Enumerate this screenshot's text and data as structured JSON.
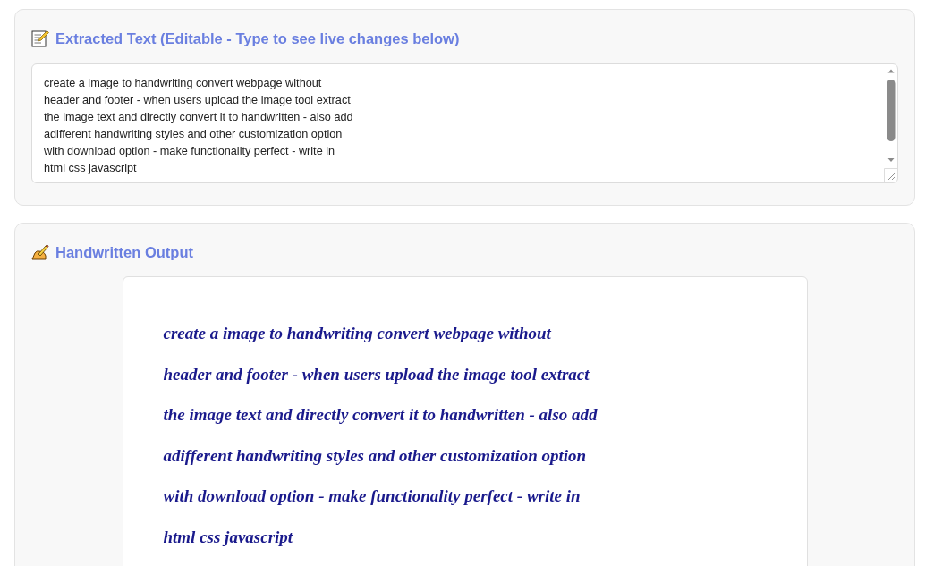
{
  "extracted_text": {
    "title": "Extracted Text (Editable - Type to see live changes below)",
    "value": "create a image to handwriting convert webpage without\nheader and footer - when users upload the image tool extract\nthe image text and directly convert it to handwritten - also add\nadifferent handwriting styles and other customization option\nwith download option - make functionality perfect - write in\nhtml css javascript"
  },
  "handwritten_output": {
    "title": "Handwritten Output",
    "text": "create a image to handwriting convert webpage without\nheader and footer - when users upload the image tool extract\nthe image text and directly convert it to handwritten - also add\nadifferent handwriting styles and other customization option\nwith download option - make functionality perfect - write in\nhtml css javascript"
  }
}
